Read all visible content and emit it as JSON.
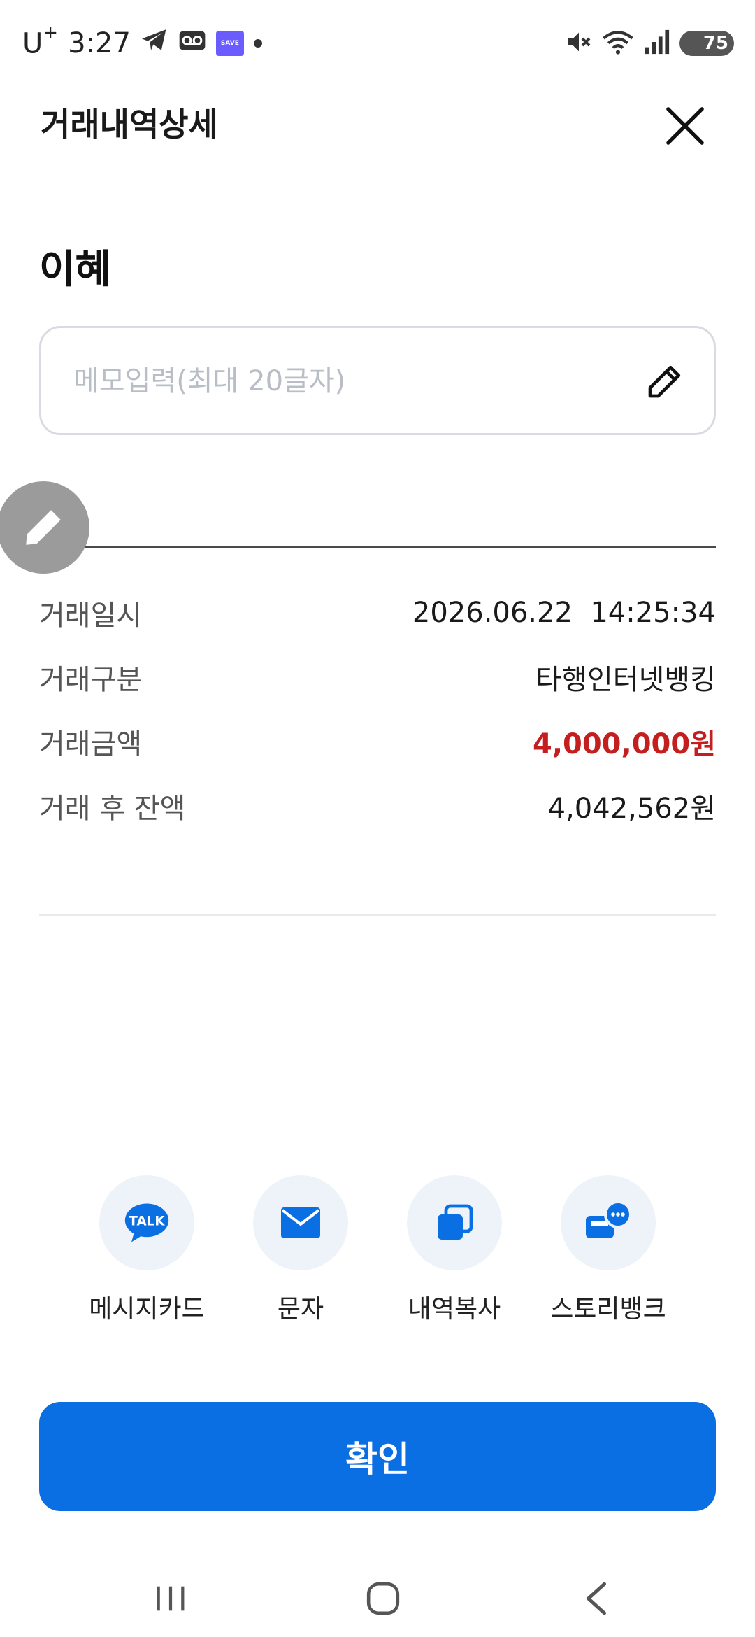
{
  "status_bar": {
    "carrier": "U",
    "carrier_sup": "+",
    "time": "3:27",
    "save_badge": "SAVE",
    "battery": "75"
  },
  "header": {
    "title": "거래내역상세",
    "close_icon": "close-icon"
  },
  "recipient": {
    "name": "이혜"
  },
  "memo": {
    "placeholder": "메모입력(최대 20글자)",
    "value": "",
    "edit_icon": "pencil-icon"
  },
  "details": {
    "rows": [
      {
        "label": "거래일시",
        "value": "2026.06.22  14:25:34"
      },
      {
        "label": "거래구분",
        "value": "타행인터넷뱅킹"
      },
      {
        "label": "거래금액",
        "value": "4,000,000원"
      },
      {
        "label": "거래 후 잔액",
        "value": "4,042,562원"
      }
    ]
  },
  "actions": [
    {
      "label": "메시지카드",
      "icon": "kakao-talk-icon",
      "icon_text": "TALK"
    },
    {
      "label": "문자",
      "icon": "mail-icon"
    },
    {
      "label": "내역복사",
      "icon": "copy-icon"
    },
    {
      "label": "스토리뱅크",
      "icon": "story-bank-icon"
    }
  ],
  "confirm": {
    "label": "확인"
  },
  "colors": {
    "primary": "#0a6fe3",
    "amount": "#c41e1e",
    "action_bg": "#eef3fa"
  }
}
